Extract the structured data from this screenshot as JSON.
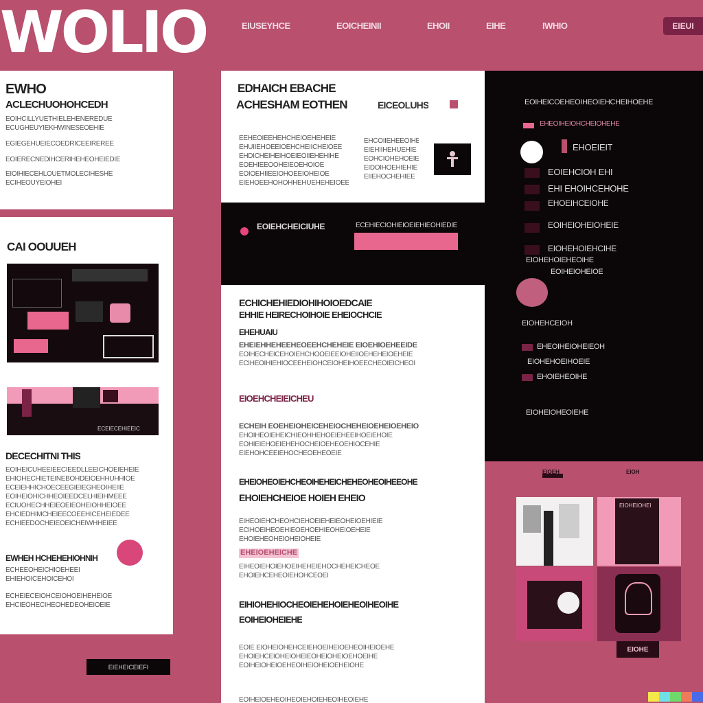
{
  "header": {
    "logo": "WOLIO",
    "nav": [
      "EIUSEYHCE",
      "EOICHEINII",
      "EHOII",
      "EIHE",
      "IWHIO"
    ],
    "cta": "EIEUI"
  },
  "left_card_top": {
    "title": "EWHO",
    "subtitle": "ACLECHUOHOHCEDH",
    "lines": [
      "EOIHCILLYUETHIELEHENEREDUE",
      "ECUGHEUYIEKHWINESEOEHIE",
      "EGIEGEHUEIECOEDRICEEIREREE",
      "EOIERECNEDIHCERIHEHEOHEIEDIE",
      "EIOIHIECEHLOUETMOLECIHESHE",
      "ECIHEOUYEIOHEI"
    ]
  },
  "left_card_main": {
    "title": "CAI OOUUEH",
    "caption": "ECEIECEHIEEIC",
    "section_title": "DECECHITNI THIS",
    "paragraph": [
      "EOIHEICUHEEIEECIEEDLLEEICHOEIEHEIE",
      "EHIOHECHIETEINEBOHDEIOEHHUHHIOE",
      "ECEIEHHICHOECEEGIEIEGHEOIHEIIE",
      "EOIHEIOHICHHEOIEEDCELHIEIHMEEE",
      "ECIUOHECHHEIEOEIEOHEIOHHEIOEE",
      "EHCIEDHIMCHEIEECOEEHICEHEIEDEE",
      "ECHIEEDOCHEIEOEICHEIWHHEIEE"
    ],
    "subsection_title": "EWHEH HCHEHEHIOHNIH",
    "subsection_lines": [
      "ECHEEOHEICHIOEHEEI",
      "EHIEHOICEHOICEHOI"
    ],
    "closing": [
      "ECHEIECEIOHCEIOHOEIHEHEIOE",
      "EHCIEOHECIHEOHEDEOHEIOEIE"
    ]
  },
  "left_footer_button": "EIEHEICEIEFI",
  "center_card_top": {
    "title": "EDHAICH EBACHE",
    "headline": "ACHESHAM EOTHEN",
    "link": "EICEOLUHS",
    "lines": [
      "EEHEOIEEHEHCHEIOEHEHEIE",
      "EHUIIEHOEEIOEHCHEIICHEIOEE",
      "EHDICHEIHEIHOEIEOIIEHEHIHE",
      "EOEHIEEOOHEIEOEHOIOE",
      "EOIOEHIIEEIOHOEEIOHEIOE",
      "EIEHOEEHOHOHHEHUEHEHEIOEE"
    ],
    "side_lines": [
      "EHCOIIEHEEOIHE",
      "EIEHIIHEHUEHIE",
      "EOHCIOHEHOEIE",
      "EIDOIHOEHIEHIE",
      "EIIEHOCHEHIEE"
    ]
  },
  "center_band": {
    "label": "EOIEHCHEICIUHE",
    "text": "ECEHIECIOHIEIOEIEHIEOHIEDIE"
  },
  "center_article": {
    "headline_1": "ECHICHEHIEDIOHIHOIOEDCAIE",
    "headline_2": "EHHIE HEIRECHOIHOIE EHEIOCHCIE",
    "kicker": "EHEHUAIU",
    "para_1": [
      "EHEIEHHEHEEHEOEEHCHEHEIE EIOEHIOEHEEIDE",
      "EOIHECHEICEHOIEHCHOOEIEEIOHEIIOEHEHEIOEHEIE",
      "ECIHEOIHIEHIOCEEHEIOHCEIOHEIHOEECHEOIEICHEOI"
    ],
    "subhead": "EIOEHCHEIEICHEU",
    "para_2": [
      "ECHEIH EOEHEIOHEICEHEIOCHEHEIOEHEIOEHEIO",
      "EHOIHEOIEHEICHIEOHHEHOEIEHEEIHOEIEHOIE",
      "EOHIEIEHOEIEHEHOCHEIOEHEOEHIOCEHIE",
      "EIEHOHCEEIEHOCHEOEHEOEIE"
    ],
    "headline_3": "EHEIOHEOIEHCHEOIHEHEICHEHEOHEOIHEEOHE",
    "headline_4": "EHOIEHCHEIOE HOIEH EHEIO",
    "para_3": [
      "EIHEOIEHCHEOHCIEHOEIEHEIEOHEIOEHIEIE",
      "ECIHOEIHEOEHIEOEHOEHIEOHEIOEHEIE",
      "EHOIEHEOHEIOHEIOHEIE"
    ],
    "pink_label": "EHEIOEHEICHE",
    "para_4": [
      "EIHEOIEHOIEHOEIHEHEIEHOCHEHEICHEOE",
      "EHOIEHCEHEOIEHOHCEOEI"
    ],
    "headline_5": "EIHIOHEHIOCHEOIEHEHOIEHEOIHEOIHE",
    "headline_6": "EOIHEIOHEIEHE",
    "para_5": [
      "EOIE EIOHEIOHEHCEIEHOEIHEIOEHEOIHEIOEHE",
      "EHOIEHCEIOHEIOHEIEOHEIOHEIOEHOEIHE",
      "EOIHEIOHEIOEHEOIHEIOHEIOEHEIOHE"
    ],
    "para_6": "EOIHEIOEHEOIHEOIEHOIEHEOIHEOIEHE"
  },
  "right_panel": {
    "top_line": "EOIHEICOEHEOIHEOIEHCHEIHOEHE",
    "pink_line": "EHEOIHEIOHCHEIOHEHE",
    "highlight": "EHOEIEIT",
    "items": [
      "EOIEHCIOH EHI",
      "EHI EHOIHCEHOHE",
      "EHOEIHCEIOHE",
      "EOIHEIOHEIOHEIE",
      "EIOHEHOIEHCIHE",
      "EIOHEHOIEHEOIHE",
      "EOIHEIOHEIOE"
    ],
    "lower_items": [
      "EIOHEHCEIOH",
      "EHEOIHEIOHEIEOH",
      "EIOHEHOEIHOEIE",
      "EHOIEHEOIHE",
      "EIOHEIOHEOIEHE"
    ]
  },
  "gallery": {
    "title": "EIOEH",
    "tag": "EIOH",
    "caption": "EIOHE",
    "card_label": "EIOHEIOHEI"
  },
  "colors": {
    "background": "#b8506e",
    "accent": "#e8678f",
    "dark": "#0b0608",
    "card": "#ffffff"
  }
}
